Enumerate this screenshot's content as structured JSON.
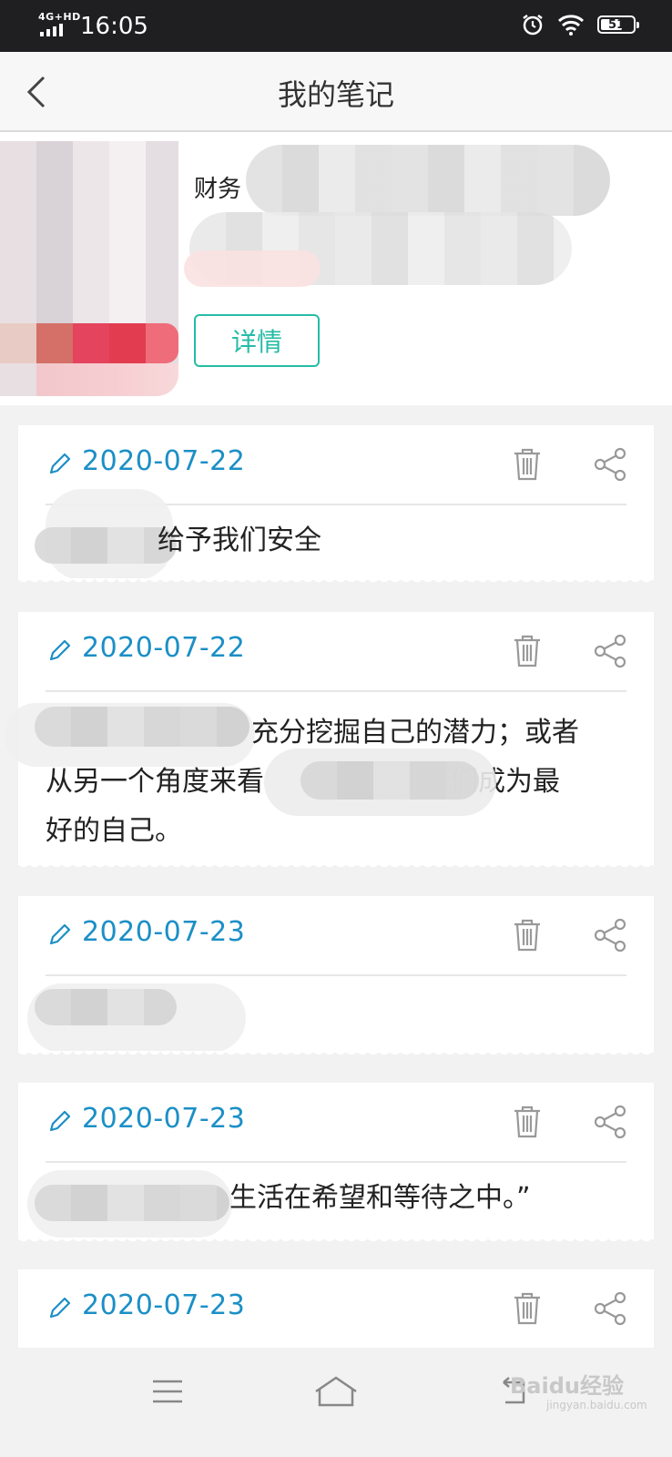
{
  "status_bar": {
    "network": "4G+HD",
    "time": "16:05",
    "battery": "51",
    "icons": [
      "signal-icon",
      "alarm-icon",
      "wifi-icon",
      "battery-icon"
    ]
  },
  "header": {
    "title": "我的笔记",
    "back_icon": "back-arrow-icon"
  },
  "book": {
    "category": "财务",
    "detail_button": "详情"
  },
  "notes": [
    {
      "date": "2020-07-22",
      "lines": [
        "给予我们安全"
      ]
    },
    {
      "date": "2020-07-22",
      "lines": [
        "充分挖掘自己的潜力；或者",
        "从另一个角度来看",
        "们成为最",
        "好的自己。"
      ]
    },
    {
      "date": "2020-07-23",
      "lines": []
    },
    {
      "date": "2020-07-23",
      "lines": [
        "生活在希望和等待之中。”"
      ]
    },
    {
      "date": "2020-07-23",
      "lines": []
    }
  ],
  "nav_bar": {
    "icons": [
      "menu-icon",
      "home-icon",
      "back-icon"
    ]
  },
  "watermark": {
    "text": "Baidu经验",
    "sub": "jingyan.baidu.com"
  },
  "colors": {
    "accent_blue": "#1b8fc6",
    "accent_teal": "#25bca6",
    "status_bar": "#1f1f22"
  }
}
